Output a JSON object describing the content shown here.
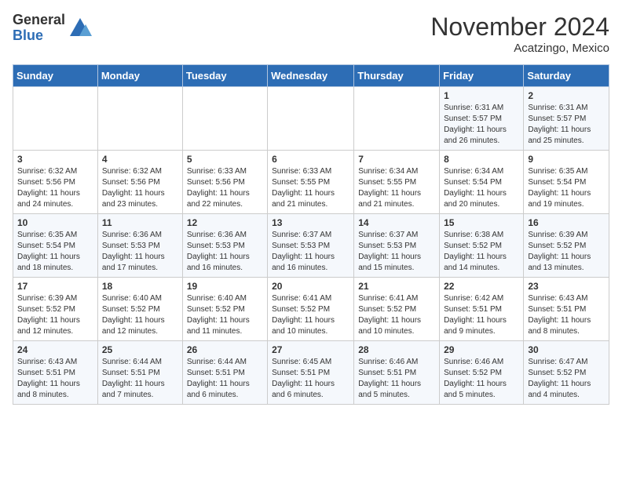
{
  "logo": {
    "general": "General",
    "blue": "Blue"
  },
  "title": "November 2024",
  "location": "Acatzingo, Mexico",
  "days_of_week": [
    "Sunday",
    "Monday",
    "Tuesday",
    "Wednesday",
    "Thursday",
    "Friday",
    "Saturday"
  ],
  "weeks": [
    [
      {
        "day": "",
        "info": ""
      },
      {
        "day": "",
        "info": ""
      },
      {
        "day": "",
        "info": ""
      },
      {
        "day": "",
        "info": ""
      },
      {
        "day": "",
        "info": ""
      },
      {
        "day": "1",
        "info": "Sunrise: 6:31 AM\nSunset: 5:57 PM\nDaylight: 11 hours and 26 minutes."
      },
      {
        "day": "2",
        "info": "Sunrise: 6:31 AM\nSunset: 5:57 PM\nDaylight: 11 hours and 25 minutes."
      }
    ],
    [
      {
        "day": "3",
        "info": "Sunrise: 6:32 AM\nSunset: 5:56 PM\nDaylight: 11 hours and 24 minutes."
      },
      {
        "day": "4",
        "info": "Sunrise: 6:32 AM\nSunset: 5:56 PM\nDaylight: 11 hours and 23 minutes."
      },
      {
        "day": "5",
        "info": "Sunrise: 6:33 AM\nSunset: 5:56 PM\nDaylight: 11 hours and 22 minutes."
      },
      {
        "day": "6",
        "info": "Sunrise: 6:33 AM\nSunset: 5:55 PM\nDaylight: 11 hours and 21 minutes."
      },
      {
        "day": "7",
        "info": "Sunrise: 6:34 AM\nSunset: 5:55 PM\nDaylight: 11 hours and 21 minutes."
      },
      {
        "day": "8",
        "info": "Sunrise: 6:34 AM\nSunset: 5:54 PM\nDaylight: 11 hours and 20 minutes."
      },
      {
        "day": "9",
        "info": "Sunrise: 6:35 AM\nSunset: 5:54 PM\nDaylight: 11 hours and 19 minutes."
      }
    ],
    [
      {
        "day": "10",
        "info": "Sunrise: 6:35 AM\nSunset: 5:54 PM\nDaylight: 11 hours and 18 minutes."
      },
      {
        "day": "11",
        "info": "Sunrise: 6:36 AM\nSunset: 5:53 PM\nDaylight: 11 hours and 17 minutes."
      },
      {
        "day": "12",
        "info": "Sunrise: 6:36 AM\nSunset: 5:53 PM\nDaylight: 11 hours and 16 minutes."
      },
      {
        "day": "13",
        "info": "Sunrise: 6:37 AM\nSunset: 5:53 PM\nDaylight: 11 hours and 16 minutes."
      },
      {
        "day": "14",
        "info": "Sunrise: 6:37 AM\nSunset: 5:53 PM\nDaylight: 11 hours and 15 minutes."
      },
      {
        "day": "15",
        "info": "Sunrise: 6:38 AM\nSunset: 5:52 PM\nDaylight: 11 hours and 14 minutes."
      },
      {
        "day": "16",
        "info": "Sunrise: 6:39 AM\nSunset: 5:52 PM\nDaylight: 11 hours and 13 minutes."
      }
    ],
    [
      {
        "day": "17",
        "info": "Sunrise: 6:39 AM\nSunset: 5:52 PM\nDaylight: 11 hours and 12 minutes."
      },
      {
        "day": "18",
        "info": "Sunrise: 6:40 AM\nSunset: 5:52 PM\nDaylight: 11 hours and 12 minutes."
      },
      {
        "day": "19",
        "info": "Sunrise: 6:40 AM\nSunset: 5:52 PM\nDaylight: 11 hours and 11 minutes."
      },
      {
        "day": "20",
        "info": "Sunrise: 6:41 AM\nSunset: 5:52 PM\nDaylight: 11 hours and 10 minutes."
      },
      {
        "day": "21",
        "info": "Sunrise: 6:41 AM\nSunset: 5:52 PM\nDaylight: 11 hours and 10 minutes."
      },
      {
        "day": "22",
        "info": "Sunrise: 6:42 AM\nSunset: 5:51 PM\nDaylight: 11 hours and 9 minutes."
      },
      {
        "day": "23",
        "info": "Sunrise: 6:43 AM\nSunset: 5:51 PM\nDaylight: 11 hours and 8 minutes."
      }
    ],
    [
      {
        "day": "24",
        "info": "Sunrise: 6:43 AM\nSunset: 5:51 PM\nDaylight: 11 hours and 8 minutes."
      },
      {
        "day": "25",
        "info": "Sunrise: 6:44 AM\nSunset: 5:51 PM\nDaylight: 11 hours and 7 minutes."
      },
      {
        "day": "26",
        "info": "Sunrise: 6:44 AM\nSunset: 5:51 PM\nDaylight: 11 hours and 6 minutes."
      },
      {
        "day": "27",
        "info": "Sunrise: 6:45 AM\nSunset: 5:51 PM\nDaylight: 11 hours and 6 minutes."
      },
      {
        "day": "28",
        "info": "Sunrise: 6:46 AM\nSunset: 5:51 PM\nDaylight: 11 hours and 5 minutes."
      },
      {
        "day": "29",
        "info": "Sunrise: 6:46 AM\nSunset: 5:52 PM\nDaylight: 11 hours and 5 minutes."
      },
      {
        "day": "30",
        "info": "Sunrise: 6:47 AM\nSunset: 5:52 PM\nDaylight: 11 hours and 4 minutes."
      }
    ]
  ]
}
